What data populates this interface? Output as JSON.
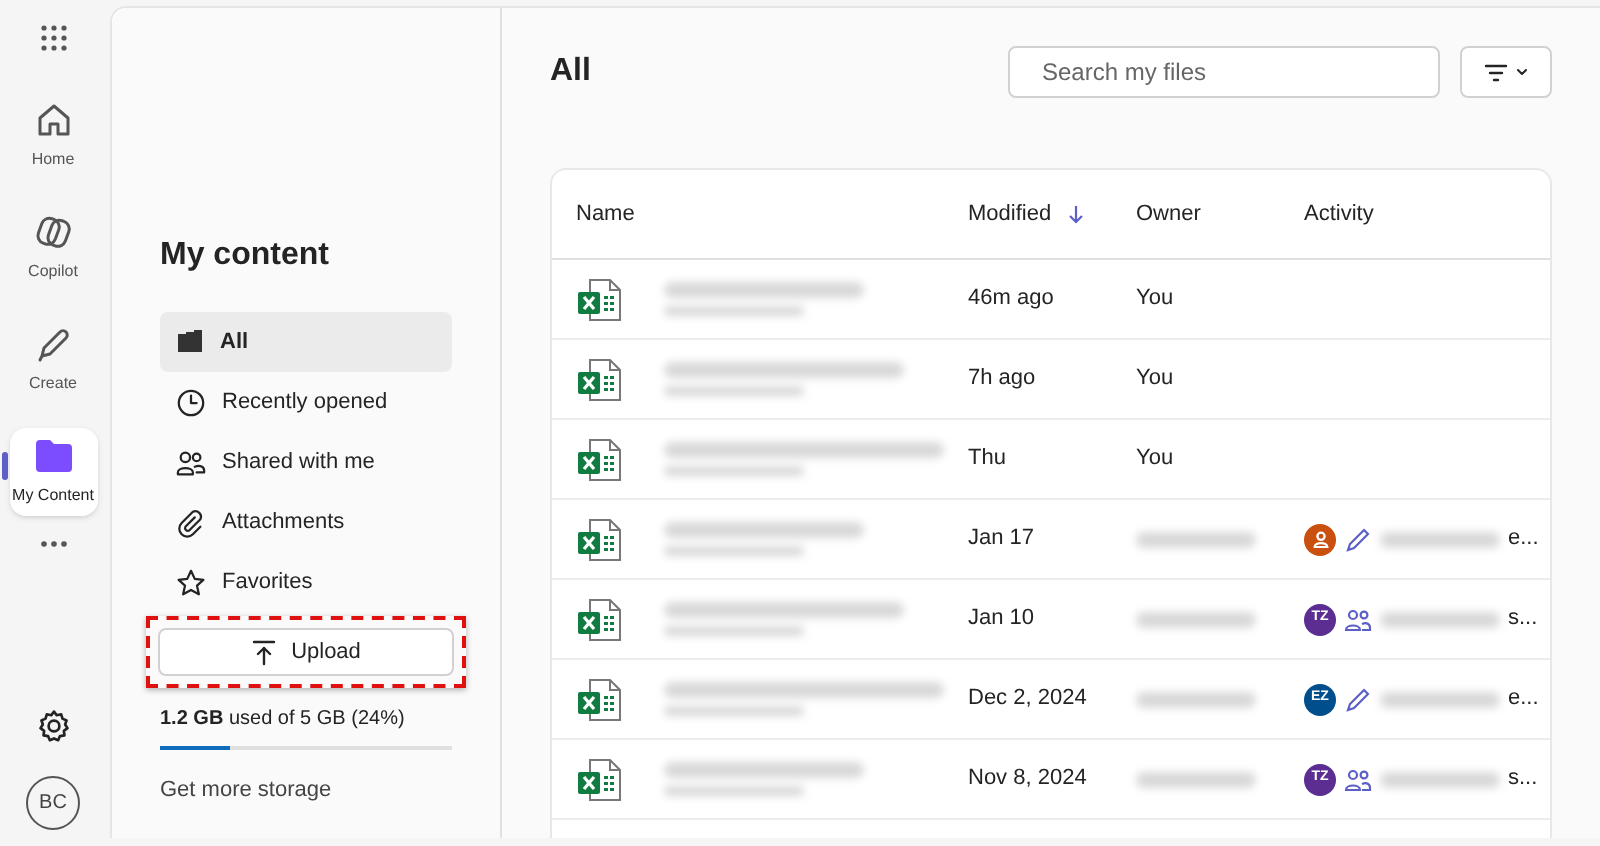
{
  "rail": {
    "items": [
      {
        "label": "Home",
        "selected": false
      },
      {
        "label": "Copilot",
        "selected": false
      },
      {
        "label": "Create",
        "selected": false
      },
      {
        "label": "My Content",
        "selected": true
      }
    ],
    "avatar": "BC"
  },
  "sidebar": {
    "title": "My content",
    "items": [
      {
        "label": "All",
        "selected": true
      },
      {
        "label": "Recently opened",
        "selected": false
      },
      {
        "label": "Shared with me",
        "selected": false
      },
      {
        "label": "Attachments",
        "selected": false
      },
      {
        "label": "Favorites",
        "selected": false
      }
    ],
    "upload": "Upload",
    "highlighted": true,
    "storage": {
      "text": "**1.2 GB** used of 5 GB (24%)",
      "level": 0.24
    },
    "more": "Get more storage"
  },
  "main": {
    "title": "All",
    "search": {
      "placeholder": "Search my files"
    },
    "table": {
      "columns": [
        {
          "label": "Name",
          "sorted": false
        },
        {
          "label": "Modified",
          "sorted": true
        },
        {
          "label": "Owner",
          "sorted": false
        },
        {
          "label": "Activity",
          "sorted": false
        }
      ],
      "rows": [
        {
          "modified": "46m ago",
          "owner": "You",
          "activity": null
        },
        {
          "modified": "7h ago",
          "owner": "You",
          "activity": null
        },
        {
          "modified": "Thu",
          "owner": "You",
          "activity": null
        },
        {
          "modified": "Jan 17",
          "owner": null,
          "activity": {
            "color": "#ca5010",
            "kind": "edit",
            "suffix": "e..."
          }
        },
        {
          "modified": "Jan 10",
          "owner": null,
          "activity": {
            "avatar": "TZ",
            "color": "#5c2e91",
            "kind": "share",
            "suffix": "s..."
          }
        },
        {
          "modified": "Dec 2, 2024",
          "owner": null,
          "activity": {
            "avatar": "EZ",
            "color": "#004e8c",
            "kind": "edit",
            "suffix": "e..."
          }
        },
        {
          "modified": "Nov 8, 2024",
          "owner": null,
          "activity": {
            "avatar": "TZ",
            "color": "#5c2e91",
            "kind": "share",
            "suffix": "s..."
          }
        }
      ]
    }
  }
}
